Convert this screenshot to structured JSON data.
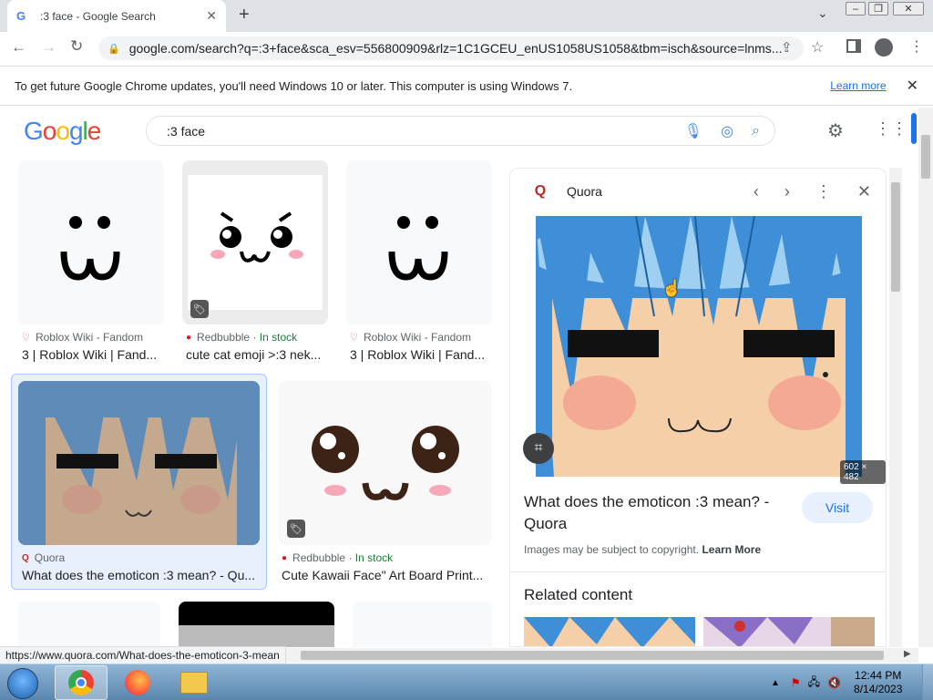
{
  "browser": {
    "tab_title": ":3 face - Google Search",
    "tab_icon": "G",
    "url": "google.com/search?q=:3+face&sca_esv=556800909&rlz=1C1GCEU_enUS1058US1058&tbm=isch&source=lnms..."
  },
  "infobar": {
    "message": "To get future Google Chrome updates, you'll need Windows 10 or later. This computer is using Windows 7.",
    "link": "Learn more"
  },
  "google": {
    "logo": "Google",
    "query": ":3 face"
  },
  "results": [
    {
      "source": "Roblox Wiki - Fandom",
      "caption": "3 | Roblox Wiki | Fand...",
      "in_stock": ""
    },
    {
      "source": "Redbubble",
      "caption": "cute cat emoji >:3 nek...",
      "in_stock": "In stock"
    },
    {
      "source": "Roblox Wiki - Fandom",
      "caption": "3 | Roblox Wiki | Fand...",
      "in_stock": ""
    },
    {
      "source": "Quora",
      "caption": "What does the emoticon :3 mean? - Qu...",
      "in_stock": ""
    },
    {
      "source": "Redbubble",
      "caption": "Cute Kawaii Face\" Art Board Print...",
      "in_stock": "In stock"
    }
  ],
  "panel": {
    "site": "Quora",
    "dimensions": "602 × 482",
    "title": "What does the emoticon :3 mean? - Quora",
    "visit_label": "Visit",
    "copyright": "Images may be subject to copyright.",
    "learn_more": "Learn More",
    "related": "Related content"
  },
  "statusbar": {
    "url": "https://www.quora.com/What-does-the-emoticon-3-mean"
  },
  "taskbar": {
    "time": "12:44 PM",
    "date": "8/14/2023"
  },
  "colors": {
    "accent": "#1a73e8",
    "quora": "#b92b27",
    "redbubble": "#e41321",
    "hair_blue": "#3f8fd8",
    "skin": "#f4cfa8"
  }
}
